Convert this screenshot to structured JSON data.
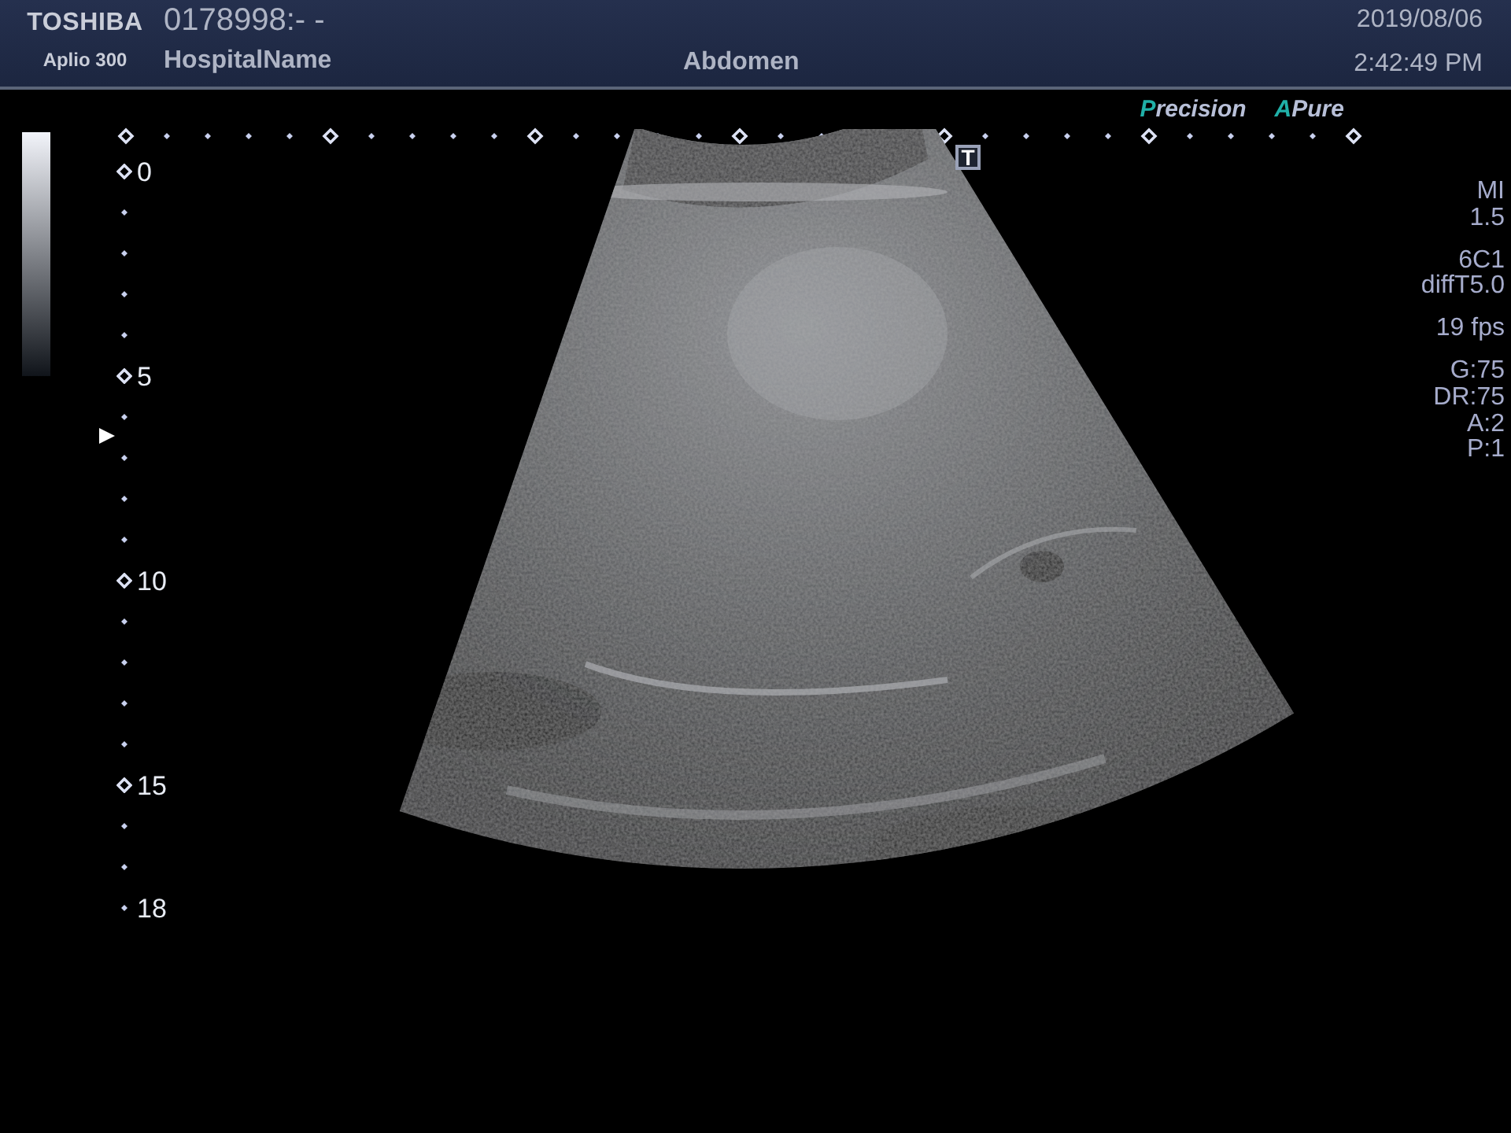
{
  "header": {
    "brand": "TOSHIBA",
    "model": "Aplio 300",
    "patient_id": "0178998:- -",
    "hospital": "HospitalName",
    "exam": "Abdomen",
    "date": "2019/08/06",
    "time": "2:42:49 PM"
  },
  "modes": [
    "Precision",
    "APure"
  ],
  "orientation_marker": "T",
  "depth_scale": [
    {
      "kind": "major",
      "label": "0"
    },
    {
      "kind": "minor"
    },
    {
      "kind": "minor"
    },
    {
      "kind": "minor"
    },
    {
      "kind": "minor"
    },
    {
      "kind": "major",
      "label": "5"
    },
    {
      "kind": "minor"
    },
    {
      "kind": "minor"
    },
    {
      "kind": "minor"
    },
    {
      "kind": "minor"
    },
    {
      "kind": "major",
      "label": "10"
    },
    {
      "kind": "minor"
    },
    {
      "kind": "minor"
    },
    {
      "kind": "minor"
    },
    {
      "kind": "minor"
    },
    {
      "kind": "major",
      "label": "15"
    },
    {
      "kind": "minor"
    },
    {
      "kind": "minor"
    },
    {
      "kind": "end",
      "label": "18"
    }
  ],
  "parameters": [
    [
      "MI",
      "1.5"
    ],
    [
      "6C1",
      "diffT5.0"
    ],
    [
      "19 fps"
    ],
    [
      "G:75",
      "DR:75",
      "A:2",
      "P:1"
    ]
  ]
}
